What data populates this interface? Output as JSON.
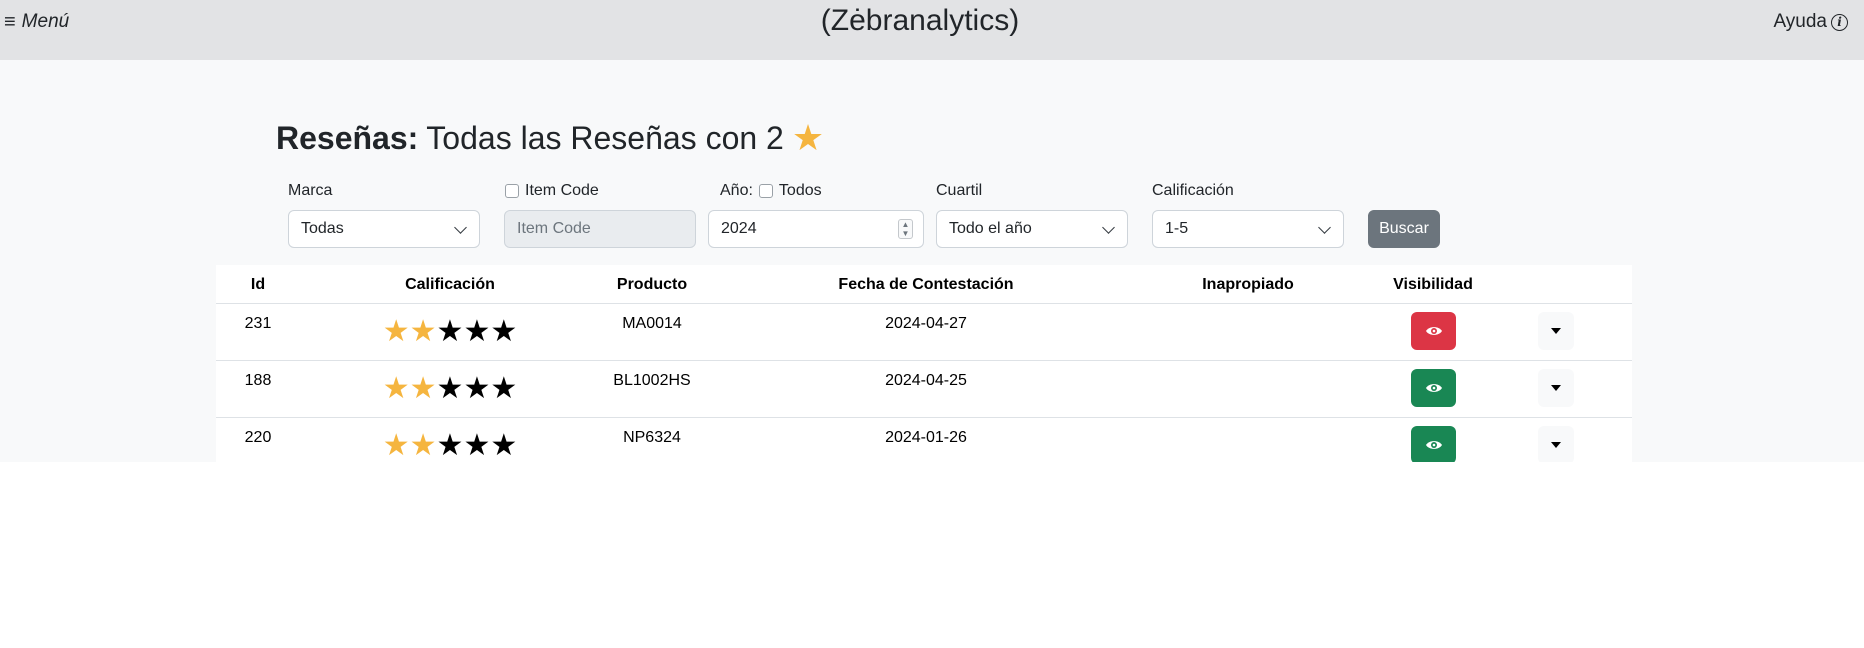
{
  "header": {
    "menu_icon": "≡",
    "menu_label": "Menú",
    "app_title": "(Zėbranalytics)",
    "help_label": "Ayuda",
    "help_icon": "i"
  },
  "page": {
    "heading_bold": "Reseñas:",
    "heading_text": "Todas las Reseñas con 2",
    "heading_icon": "star-icon"
  },
  "filters": {
    "brand": {
      "label": "Marca",
      "value": "Todas"
    },
    "item_code": {
      "label": "Item Code",
      "placeholder": "Item Code",
      "checked": false
    },
    "year": {
      "label": "Año:",
      "all_label": "Todos",
      "all_checked": false,
      "value": "2024"
    },
    "quartile": {
      "label": "Cuartil",
      "value": "Todo el año"
    },
    "rating": {
      "label": "Calificación",
      "value": "1-5"
    },
    "search_label": "Buscar"
  },
  "table": {
    "columns": [
      "Id",
      "Calificación",
      "Producto",
      "Fecha de Contestación",
      "Inapropiado",
      "Visibilidad"
    ],
    "rows": [
      {
        "id": "231",
        "rating": 2,
        "max_rating": 5,
        "product": "MA0014",
        "date": "2024-04-27",
        "inappropriate": "",
        "visibility": "hidden"
      },
      {
        "id": "188",
        "rating": 2,
        "max_rating": 5,
        "product": "BL1002HS",
        "date": "2024-04-25",
        "inappropriate": "",
        "visibility": "visible"
      },
      {
        "id": "220",
        "rating": 2,
        "max_rating": 5,
        "product": "NP6324",
        "date": "2024-01-26",
        "inappropriate": "",
        "visibility": "visible"
      }
    ]
  },
  "colors": {
    "star_on": "#f5b53f",
    "star_off": "#000000",
    "visibility_hidden": "#dc3545",
    "visibility_visible": "#198754"
  }
}
